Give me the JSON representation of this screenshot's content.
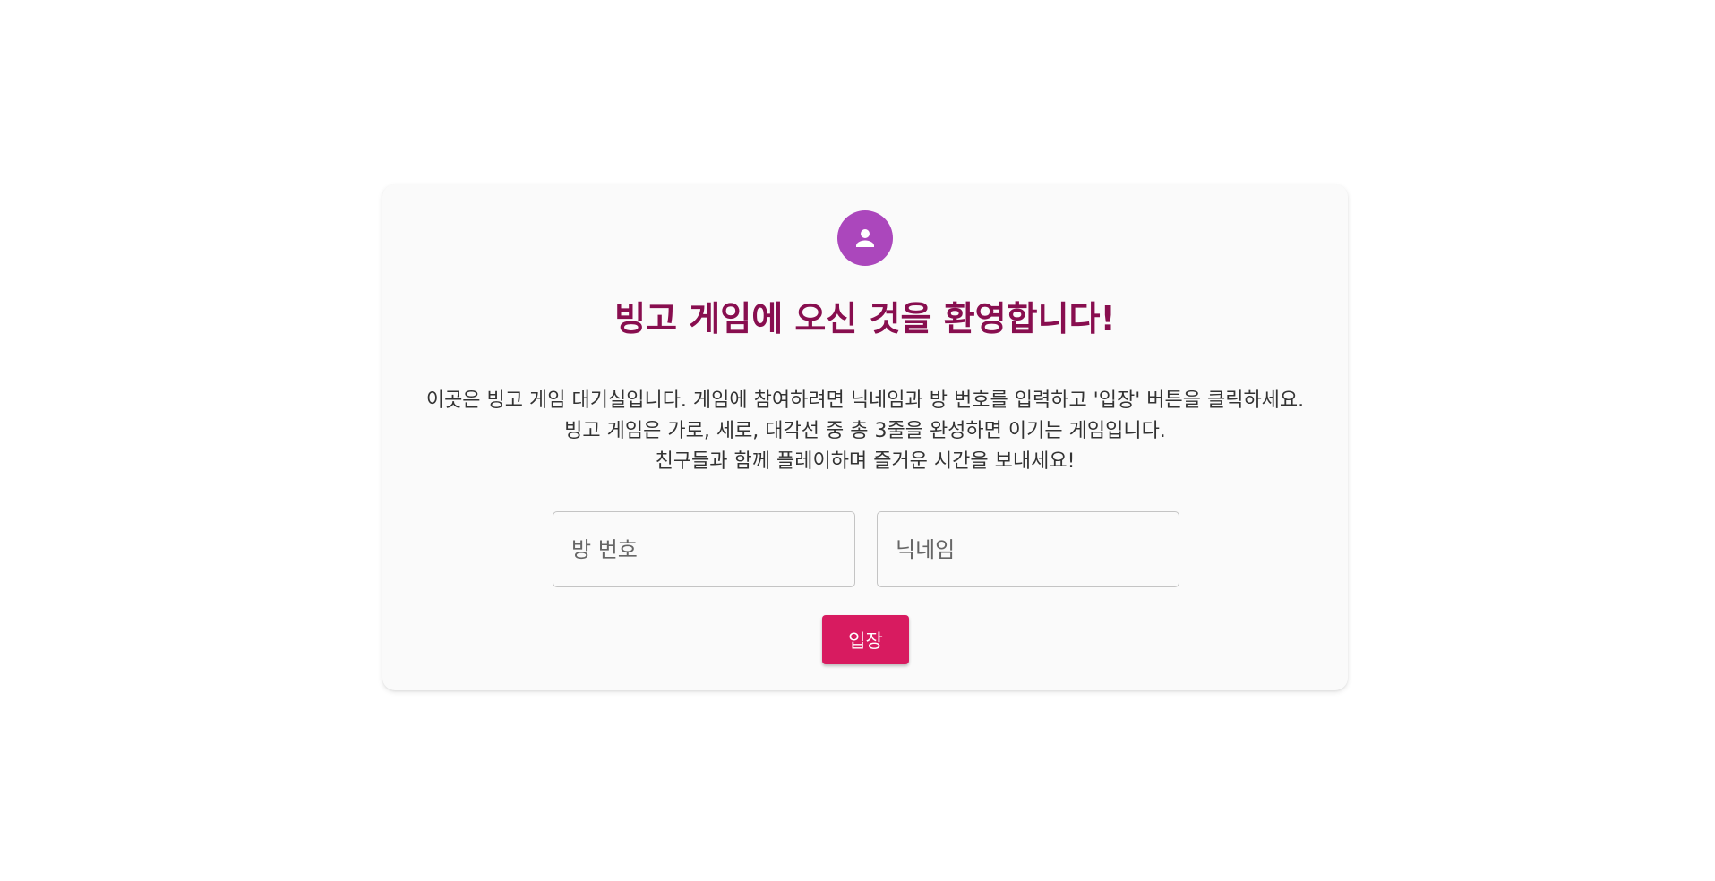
{
  "lobby": {
    "avatar_icon": "person-icon",
    "title": "빙고 게임에 오신 것을 환영합니다!",
    "description": [
      "이곳은 빙고 게임 대기실입니다. 게임에 참여하려면 닉네임과 방 번호를 입력하고 '입장' 버튼을 클릭하세요.",
      "빙고 게임은 가로, 세로, 대각선 중 총 3줄을 완성하면 이기는 게임입니다.",
      "친구들과 함께 플레이하며 즐거운 시간을 보내세요!"
    ],
    "room_input": {
      "placeholder": "방 번호",
      "value": ""
    },
    "nickname_input": {
      "placeholder": "닉네임",
      "value": ""
    },
    "enter_label": "입장"
  },
  "colors": {
    "avatar_bg": "#ab47bc",
    "title": "#880e4f",
    "button": "#d81b60"
  }
}
